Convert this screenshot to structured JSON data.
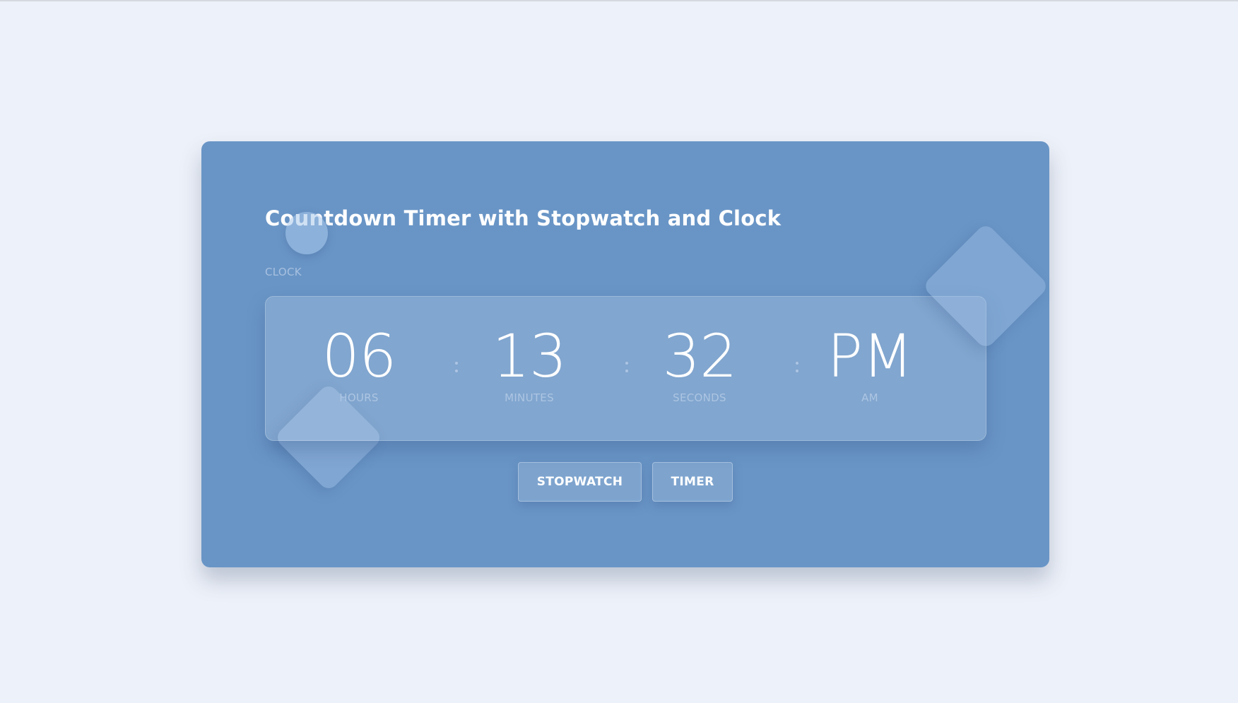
{
  "page": {
    "title": "Countdown Timer with Stopwatch and Clock",
    "mode_label": "CLOCK"
  },
  "clock": {
    "hours": {
      "value": "06",
      "label": "HOURS"
    },
    "minutes": {
      "value": "13",
      "label": "MINUTES"
    },
    "seconds": {
      "value": "32",
      "label": "SECONDS"
    },
    "period": {
      "value": "PM",
      "label": "AM"
    }
  },
  "buttons": {
    "stopwatch": "STOPWATCH",
    "timer": "TIMER"
  },
  "colors": {
    "background": "#edf1f9",
    "card": "#6995c6",
    "text": "#ffffff",
    "muted_text": "#adc5e3"
  }
}
